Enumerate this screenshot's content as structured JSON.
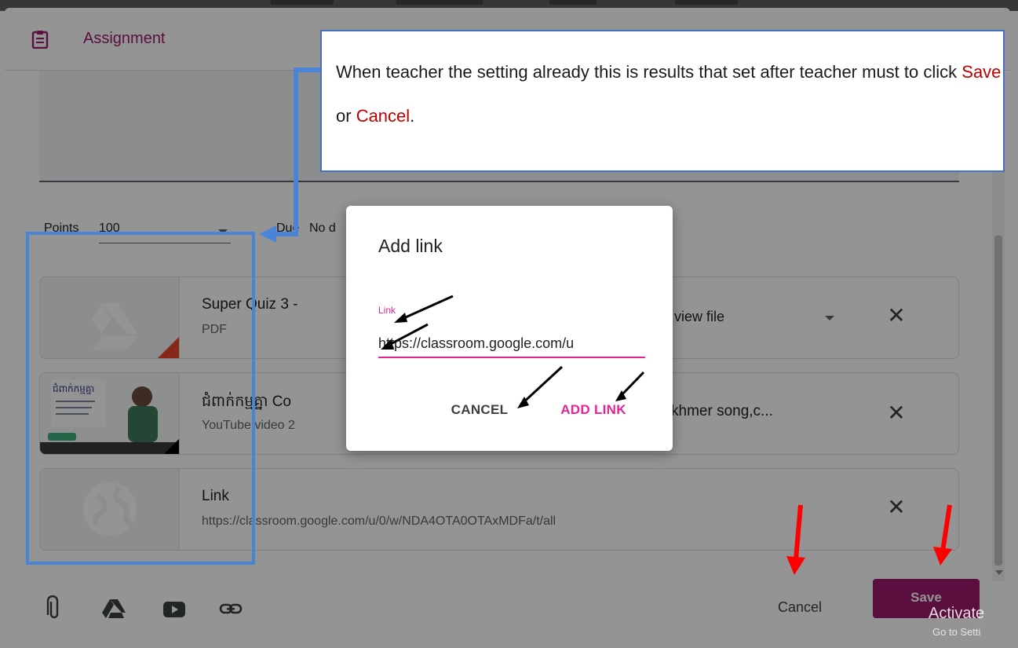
{
  "dialog": {
    "title": "Assignment",
    "points_label": "Points",
    "points_value": "100",
    "due_label": "Due",
    "due_value": "No d"
  },
  "attachments": [
    {
      "title": "Super Quiz 3 -",
      "subtitle": "PDF",
      "share_option": "view file",
      "icon": "google-drive-icon"
    },
    {
      "title": "ជំពាក់កម្មគ្នា Co",
      "title_right": "khmer song,c...",
      "subtitle": "YouTube video  2",
      "thumbnail_text": "ជំពាក់កម្មគ្នា",
      "icon": "youtube-thumbnail"
    },
    {
      "title": "Link",
      "subtitle": "https://classroom.google.com/u/0/w/NDA4OTA0OTAxMDFa/t/all",
      "icon": "globe-icon"
    }
  ],
  "toolbar": {
    "icons": [
      "paperclip-icon",
      "google-drive-icon",
      "youtube-icon",
      "link-icon"
    ],
    "cancel_label": "Cancel",
    "save_label": "Save"
  },
  "add_link_dialog": {
    "title": "Add link",
    "field_label": "Link",
    "field_value": "https://classroom.google.com/u",
    "cancel_label": "CANCEL",
    "add_label": "ADD LINK"
  },
  "callout": {
    "text_before": "When teacher the setting already this is results that set after teacher must to click ",
    "save_word": "Save",
    "or_word": " or ",
    "cancel_word": "Cancel",
    "text_end": "."
  },
  "watermark": {
    "line1": "Activate",
    "line2": "Go to Setti"
  },
  "colors": {
    "brand": "#9c1b6b",
    "accent_pink": "#e52592",
    "annotation_blue": "#4472c4",
    "annotation_red": "#c00000",
    "arrow_red": "#ff0000"
  }
}
